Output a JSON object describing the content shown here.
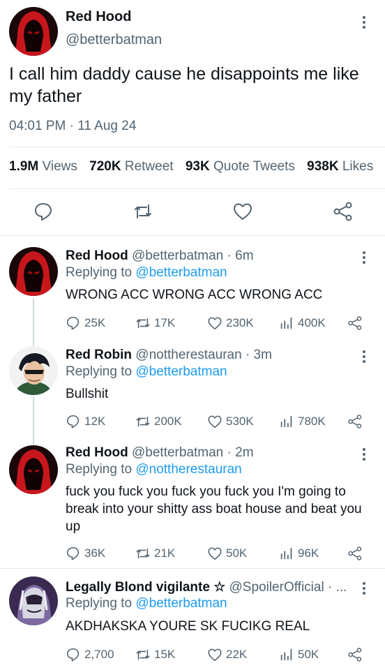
{
  "main_tweet": {
    "display_name": "Red Hood",
    "handle": "@betterbatman",
    "text": "I call him daddy cause he disappoints me like my father",
    "timestamp": "04:01 PM · 11 Aug 24",
    "stats": [
      {
        "value": "1.9M",
        "label": "Views"
      },
      {
        "value": "720K",
        "label": "Retweet"
      },
      {
        "value": "93K",
        "label": "Quote Tweets"
      },
      {
        "value": "938K",
        "label": "Likes"
      }
    ]
  },
  "replies": [
    {
      "display_name": "Red Hood",
      "handle_time": "@betterbatman · 6m",
      "replying_prefix": "Replying to",
      "replying_to": "@betterbatman",
      "text": "WRONG ACC WRONG ACC WRONG ACC",
      "replies": "25K",
      "retweets": "17K",
      "likes": "230K",
      "views": "400K",
      "avatar": "red-hood"
    },
    {
      "display_name": "Red Robin",
      "handle_time": "@nottherestauran · 3m",
      "replying_prefix": "Replying to",
      "replying_to": "@betterbatman",
      "text": "Bullshit",
      "replies": "12K",
      "retweets": "200K",
      "likes": "530K",
      "views": "780K",
      "avatar": "red-robin"
    },
    {
      "display_name": "Red Hood",
      "handle_time": "@betterbatman · 2m",
      "replying_prefix": "Replying to",
      "replying_to": "@nottherestauran",
      "text": "fuck you fuck you fuck you fuck you I'm going to break into your shitty ass boat house and beat you up",
      "replies": "36K",
      "retweets": "21K",
      "likes": "50K",
      "views": "96K",
      "avatar": "red-hood"
    },
    {
      "display_name": "Legally Blond vigilante ☆",
      "handle_time": "@SpoilerOfficial · ...",
      "replying_prefix": "Replying to",
      "replying_to": "@betterbatman",
      "text": "AKDHAKSKA YOURE SK FUCIKG REAL",
      "replies": "2,700",
      "retweets": "15K",
      "likes": "22K",
      "views": "50K",
      "avatar": "spoiler"
    }
  ],
  "colors": {
    "accent": "#1d9bf0",
    "muted": "#536471",
    "hood_red": "#c8161d",
    "divider": "#e6e9eb"
  }
}
